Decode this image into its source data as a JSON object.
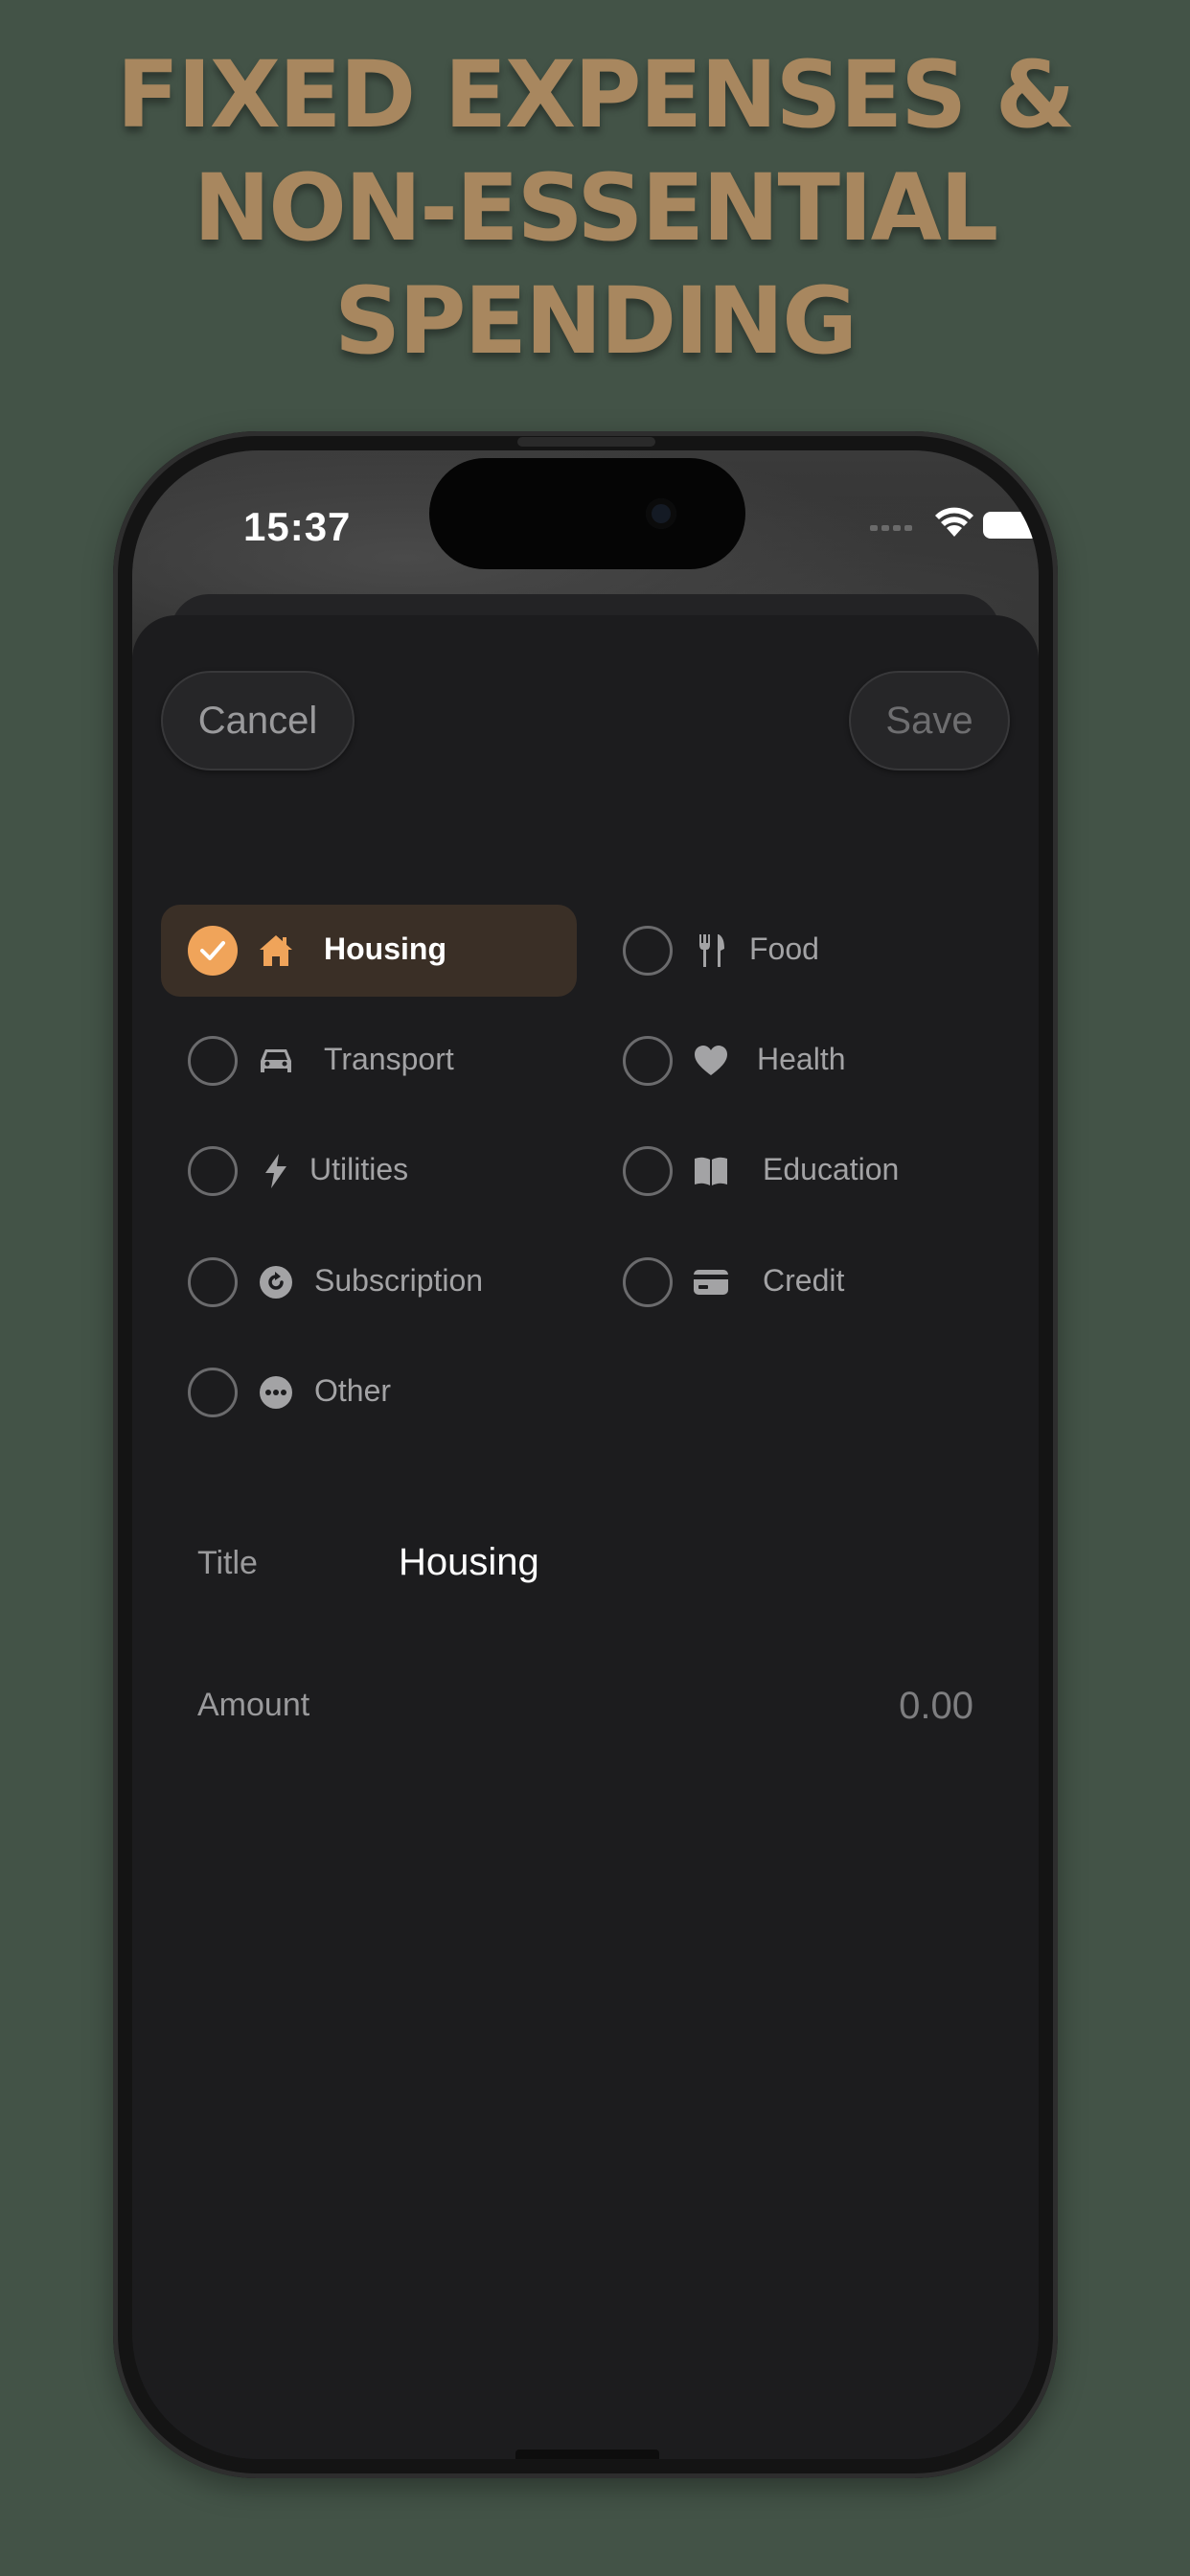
{
  "headline": {
    "line1": "FIXED EXPENSES &",
    "line2": "NON-ESSENTIAL",
    "line3": "SPENDING",
    "color": "#a8875f"
  },
  "status_bar": {
    "time": "15:37",
    "icons": [
      "cellular-signal-icon",
      "wifi-icon",
      "battery-icon"
    ]
  },
  "toolbar": {
    "cancel_label": "Cancel",
    "save_label": "Save"
  },
  "categories": [
    {
      "label": "Housing",
      "icon": "house-icon",
      "selected": true
    },
    {
      "label": "Food",
      "icon": "fork-knife-icon",
      "selected": false
    },
    {
      "label": "Transport",
      "icon": "car-icon",
      "selected": false
    },
    {
      "label": "Health",
      "icon": "heart-icon",
      "selected": false
    },
    {
      "label": "Utilities",
      "icon": "bolt-icon",
      "selected": false
    },
    {
      "label": "Education",
      "icon": "book-icon",
      "selected": false
    },
    {
      "label": "Subscription",
      "icon": "refresh-icon",
      "selected": false
    },
    {
      "label": "Credit",
      "icon": "credit-card-icon",
      "selected": false
    },
    {
      "label": "Other",
      "icon": "ellipsis-icon",
      "selected": false
    }
  ],
  "form": {
    "title_label": "Title",
    "title_value": "Housing",
    "amount_label": "Amount",
    "amount_value": "0.00"
  },
  "colors": {
    "accent": "#f0a45a",
    "background": "#435347",
    "sheet": "#1c1c1e",
    "selected_row": "#3a2f26"
  }
}
